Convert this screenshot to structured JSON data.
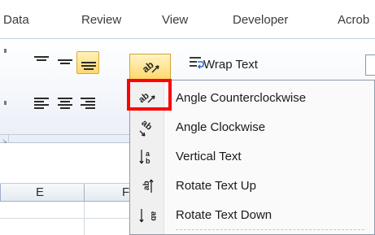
{
  "tabs": [
    {
      "label": "Data"
    },
    {
      "label": "Review"
    },
    {
      "label": "View"
    },
    {
      "label": "Developer"
    },
    {
      "label": "Acrob"
    }
  ],
  "ribbon": {
    "wrap_text_label": "Wrap Text",
    "wrap_text_icon": "wrap-text-icon",
    "align_top_icon": "align-top-icon",
    "align_middle_icon": "align-middle-icon",
    "align_bottom_icon": "align-bottom-icon",
    "align_left_icon": "align-left-icon",
    "align_center_icon": "align-center-icon",
    "align_right_icon": "align-right-icon",
    "orientation_icon": "text-orientation-icon",
    "dialog_launcher_icon": "dialog-launcher-icon"
  },
  "columns": [
    {
      "label": "E"
    },
    {
      "label": "F"
    }
  ],
  "orientation_menu": {
    "items": [
      {
        "label": "Angle Counterclockwise",
        "icon": "angle-counterclockwise-icon"
      },
      {
        "label": "Angle Clockwise",
        "icon": "angle-clockwise-icon"
      },
      {
        "label": "Vertical Text",
        "icon": "vertical-text-icon"
      },
      {
        "label": "Rotate Text Up",
        "icon": "rotate-text-up-icon"
      },
      {
        "label": "Rotate Text Down",
        "icon": "rotate-text-down-icon"
      }
    ]
  },
  "colors": {
    "highlight": "#ff0000",
    "active_button": "#ffd86a",
    "menu_background": "#fafafa"
  }
}
